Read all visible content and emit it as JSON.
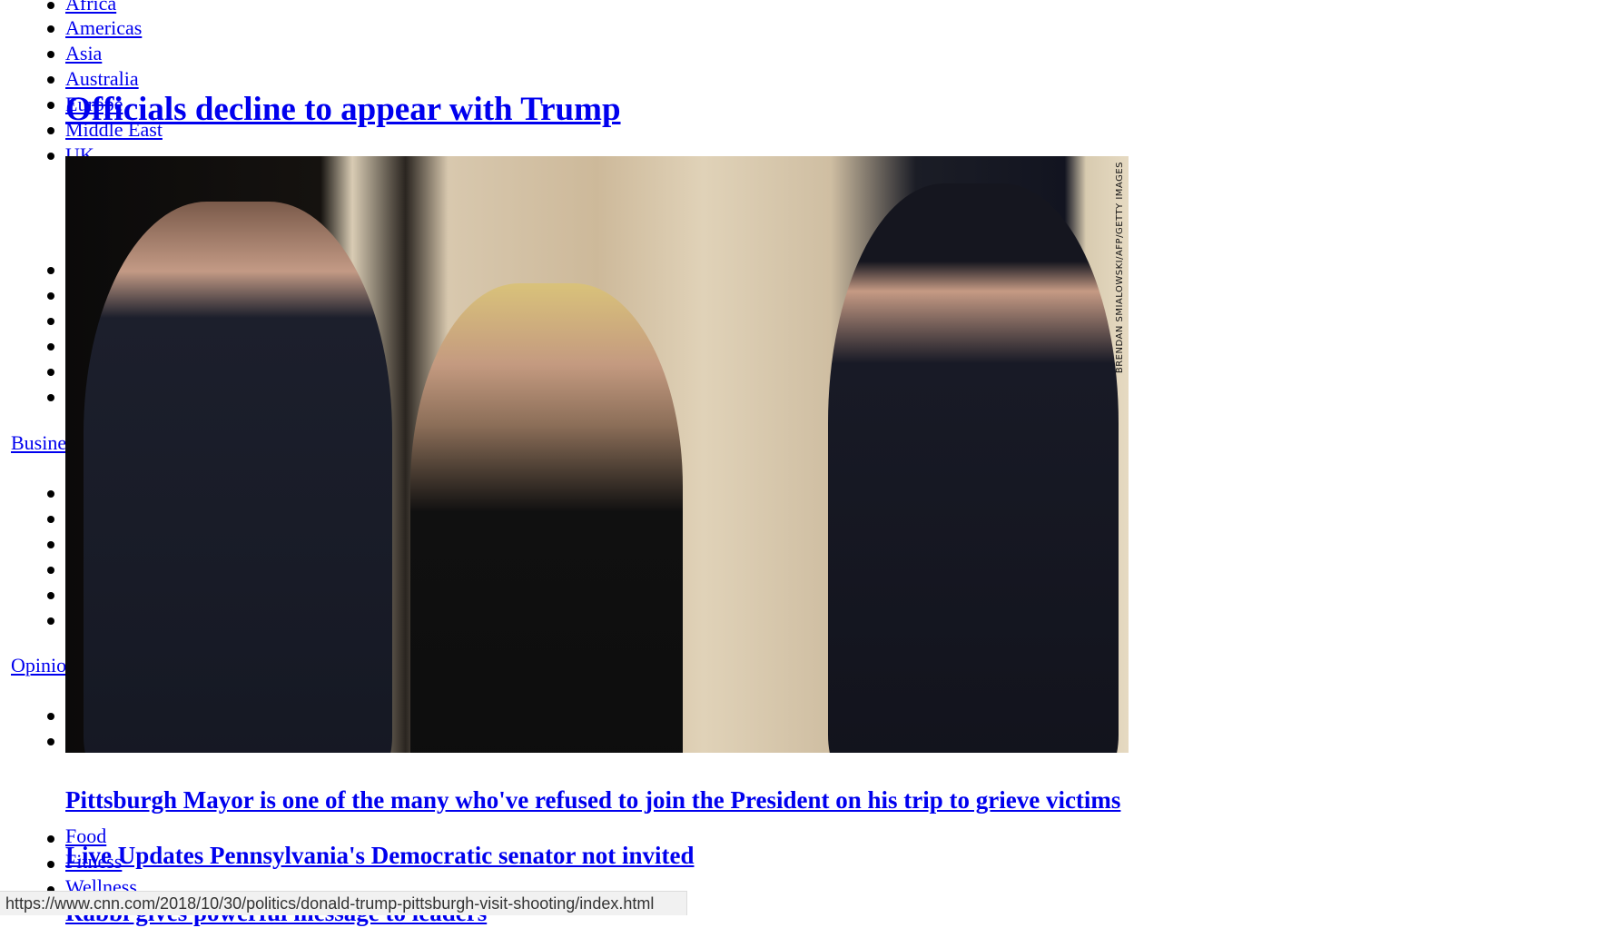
{
  "nav": {
    "world_items": [
      "Africa",
      "Americas",
      "Asia",
      "Australia",
      "Europe",
      "Middle East",
      "UK"
    ],
    "business_label": "Business",
    "opinion_label": "Opinion",
    "health_items": [
      "Food",
      "Fitness",
      "Wellness"
    ]
  },
  "article": {
    "headline": "Officials decline to appear with Trump",
    "image_credit": "BRENDAN SMIALOWSKI/AFP/GETTY IMAGES",
    "caption_link": "Pittsburgh Mayor is one of the many who've refused to join the President on his trip to grieve victims",
    "live_updates_link": "Live Updates Pennsylvania's Democratic senator not invited",
    "partial_link": "Rabbi gives powerful message to leaders"
  },
  "status_bar": {
    "url": "https://www.cnn.com/2018/10/30/politics/donald-trump-pittsburgh-visit-shooting/index.html"
  },
  "colors": {
    "link": "#0000ee",
    "status_bg": "#f1f1f1"
  }
}
